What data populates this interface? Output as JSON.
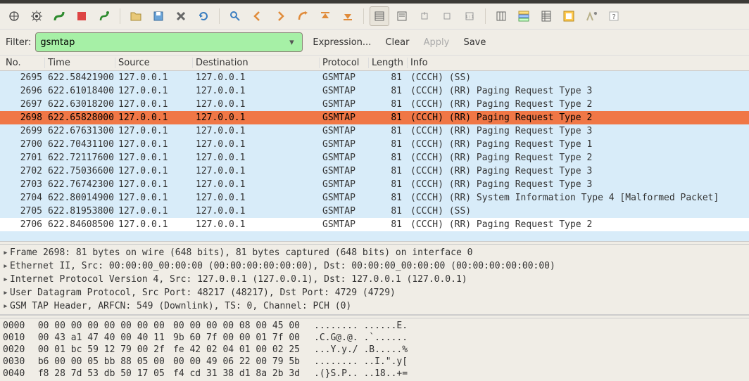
{
  "filter": {
    "label": "Filter:",
    "value": "gsmtap",
    "expression": "Expression...",
    "clear": "Clear",
    "apply": "Apply",
    "save": "Save"
  },
  "columns": {
    "no": "No.",
    "time": "Time",
    "source": "Source",
    "destination": "Destination",
    "protocol": "Protocol",
    "length": "Length",
    "info": "Info"
  },
  "packets": [
    {
      "no": "2695",
      "time": "622.58421900",
      "src": "127.0.0.1",
      "dst": "127.0.0.1",
      "proto": "GSMTAP",
      "len": "81",
      "info": "(CCCH) (SS)",
      "sel": false,
      "white": false
    },
    {
      "no": "2696",
      "time": "622.61018400",
      "src": "127.0.0.1",
      "dst": "127.0.0.1",
      "proto": "GSMTAP",
      "len": "81",
      "info": "(CCCH) (RR) Paging Request Type 3",
      "sel": false,
      "white": false
    },
    {
      "no": "2697",
      "time": "622.63018200",
      "src": "127.0.0.1",
      "dst": "127.0.0.1",
      "proto": "GSMTAP",
      "len": "81",
      "info": "(CCCH) (RR) Paging Request Type 2",
      "sel": false,
      "white": false
    },
    {
      "no": "2698",
      "time": "622.65828000",
      "src": "127.0.0.1",
      "dst": "127.0.0.1",
      "proto": "GSMTAP",
      "len": "81",
      "info": "(CCCH) (RR) Paging Request Type 2",
      "sel": true,
      "white": false
    },
    {
      "no": "2699",
      "time": "622.67631300",
      "src": "127.0.0.1",
      "dst": "127.0.0.1",
      "proto": "GSMTAP",
      "len": "81",
      "info": "(CCCH) (RR) Paging Request Type 3",
      "sel": false,
      "white": false
    },
    {
      "no": "2700",
      "time": "622.70431100",
      "src": "127.0.0.1",
      "dst": "127.0.0.1",
      "proto": "GSMTAP",
      "len": "81",
      "info": "(CCCH) (RR) Paging Request Type 1",
      "sel": false,
      "white": false
    },
    {
      "no": "2701",
      "time": "622.72117600",
      "src": "127.0.0.1",
      "dst": "127.0.0.1",
      "proto": "GSMTAP",
      "len": "81",
      "info": "(CCCH) (RR) Paging Request Type 2",
      "sel": false,
      "white": false
    },
    {
      "no": "2702",
      "time": "622.75036600",
      "src": "127.0.0.1",
      "dst": "127.0.0.1",
      "proto": "GSMTAP",
      "len": "81",
      "info": "(CCCH) (RR) Paging Request Type 3",
      "sel": false,
      "white": false
    },
    {
      "no": "2703",
      "time": "622.76742300",
      "src": "127.0.0.1",
      "dst": "127.0.0.1",
      "proto": "GSMTAP",
      "len": "81",
      "info": "(CCCH) (RR) Paging Request Type 3",
      "sel": false,
      "white": false
    },
    {
      "no": "2704",
      "time": "622.80014900",
      "src": "127.0.0.1",
      "dst": "127.0.0.1",
      "proto": "GSMTAP",
      "len": "81",
      "info": "(CCCH) (RR) System Information Type 4 [Malformed Packet]",
      "sel": false,
      "white": false
    },
    {
      "no": "2705",
      "time": "622.81953800",
      "src": "127.0.0.1",
      "dst": "127.0.0.1",
      "proto": "GSMTAP",
      "len": "81",
      "info": "(CCCH) (SS)",
      "sel": false,
      "white": false
    },
    {
      "no": "2706",
      "time": "622.84608500",
      "src": "127.0.0.1",
      "dst": "127.0.0.1",
      "proto": "GSMTAP",
      "len": "81",
      "info": "(CCCH) (RR) Paging Request Type 2",
      "sel": false,
      "white": true
    }
  ],
  "details": [
    "Frame 2698: 81 bytes on wire (648 bits), 81 bytes captured (648 bits) on interface 0",
    "Ethernet II, Src: 00:00:00_00:00:00 (00:00:00:00:00:00), Dst: 00:00:00_00:00:00 (00:00:00:00:00:00)",
    "Internet Protocol Version 4, Src: 127.0.0.1 (127.0.0.1), Dst: 127.0.0.1 (127.0.0.1)",
    "User Datagram Protocol, Src Port: 48217 (48217), Dst Port: 4729 (4729)",
    "GSM TAP Header, ARFCN: 549 (Downlink), TS: 0, Channel: PCH (0)"
  ],
  "hex": [
    {
      "off": "0000",
      "b1": "00 00 00 00 00 00 00 00",
      "b2": "00 00 00 00 08 00 45 00",
      "asc": "........ ......E."
    },
    {
      "off": "0010",
      "b1": "00 43 a1 47 40 00 40 11",
      "b2": "9b 60 7f 00 00 01 7f 00",
      "asc": ".C.G@.@. .`......"
    },
    {
      "off": "0020",
      "b1": "00 01 bc 59 12 79 00 2f",
      "b2": "fe 42 02 04 01 00 02 25",
      "asc": "...Y.y./ .B.....%"
    },
    {
      "off": "0030",
      "b1": "b6 00 00 05 bb 88 05 00",
      "b2": "00 00 49 06 22 00 79 5b",
      "asc": "........ ..I.\".y["
    },
    {
      "off": "0040",
      "b1": "f8 28 7d 53 db 50 17 05",
      "b2": "f4 cd 31 38 d1 8a 2b 3d",
      "asc": ".(}S.P.. ..18..+="
    }
  ]
}
